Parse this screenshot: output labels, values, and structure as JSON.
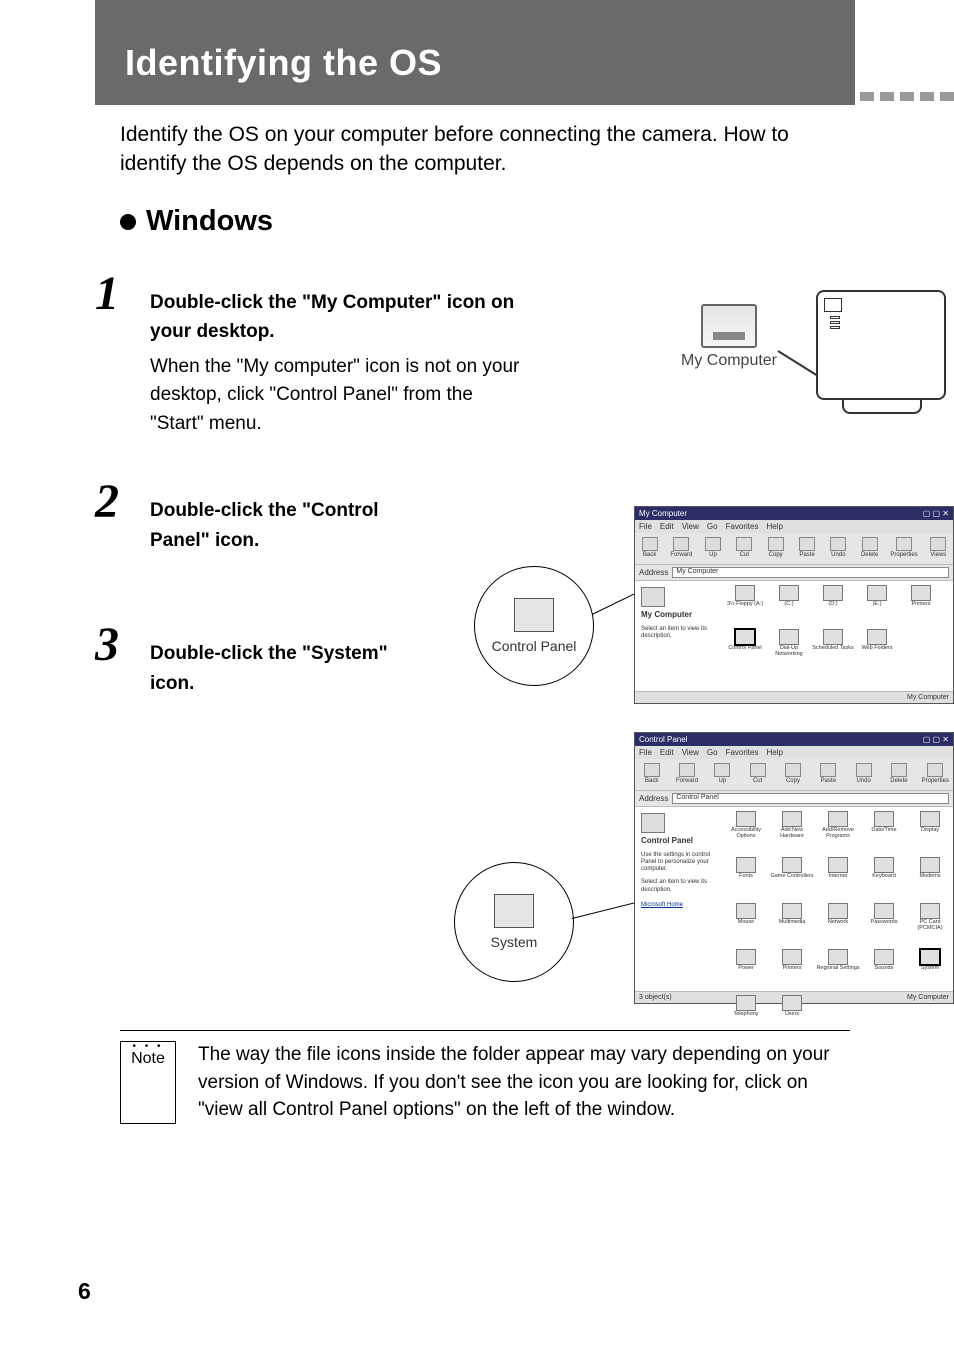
{
  "page": {
    "title": "Identifying the OS",
    "intro": "Identify the OS on your computer before connecting the camera. How to identify the OS depends on the computer.",
    "section": "Windows",
    "page_number": "6"
  },
  "steps": {
    "one": {
      "num": "1",
      "instruction": "Double-click the \"My Computer\" icon on your desktop.",
      "desc": "When the \"My computer\" icon is not on your desktop, click \"Control Panel\" from the  \"Start\" menu.",
      "icon_label": "My Computer"
    },
    "two": {
      "num": "2",
      "instruction": "Double-click the \"Control Panel\" icon.",
      "callout_label": "Control Panel",
      "window": {
        "title": "My Computer",
        "menubar": [
          "File",
          "Edit",
          "View",
          "Go",
          "Favorites",
          "Help"
        ],
        "toolbar": [
          {
            "label": "Back"
          },
          {
            "label": "Forward"
          },
          {
            "label": "Up"
          },
          {
            "label": "Cut"
          },
          {
            "label": "Copy"
          },
          {
            "label": "Paste"
          },
          {
            "label": "Undo"
          },
          {
            "label": "Delete"
          },
          {
            "label": "Properties"
          },
          {
            "label": "Views"
          }
        ],
        "address_label": "Address",
        "address_value": "My Computer",
        "left_title": "My Computer",
        "left_desc": "Select an item to view its description.",
        "icons": [
          "3½ Floppy (A:)",
          "(C:)",
          "(D:)",
          "(E:)",
          "Printers",
          "Control Panel",
          "Dial-Up Networking",
          "Scheduled Tasks",
          "Web Folders"
        ],
        "status_right": "My Computer"
      }
    },
    "three": {
      "num": "3",
      "instruction": "Double-click the \"System\" icon.",
      "callout_label": "System",
      "window": {
        "title": "Control Panel",
        "menubar": [
          "File",
          "Edit",
          "View",
          "Go",
          "Favorites",
          "Help"
        ],
        "toolbar": [
          {
            "label": "Back"
          },
          {
            "label": "Forward"
          },
          {
            "label": "Up"
          },
          {
            "label": "Cut"
          },
          {
            "label": "Copy"
          },
          {
            "label": "Paste"
          },
          {
            "label": "Undo"
          },
          {
            "label": "Delete"
          },
          {
            "label": "Properties"
          }
        ],
        "address_label": "Address",
        "address_value": "Control Panel",
        "left_title": "Control Panel",
        "left_desc": "Use the settings in control Panel to personalize your computer.",
        "left_desc2": "Select an item to view its description.",
        "left_link": "Microsoft Home",
        "icons": [
          "Accessibility Options",
          "Add New Hardware",
          "Add/Remove Programs",
          "Date/Time",
          "Display",
          "Fonts",
          "Game Controllers",
          "Internet",
          "Keyboard",
          "Modems",
          "Mouse",
          "Multimedia",
          "Network",
          "Passwords",
          "PC Card (PCMCIA)",
          "Power",
          "Printers",
          "Regional Settings",
          "Sounds",
          "System",
          "Telephony",
          "Users"
        ],
        "status_left": "3 object(s)",
        "status_right": "My Computer"
      }
    }
  },
  "note": {
    "badge": "Note",
    "text": "The way the file icons inside the folder appear may vary depending on your version of Windows. If you don't see the icon you are looking for, click on \"view all Control Panel options\" on the left of the window."
  }
}
